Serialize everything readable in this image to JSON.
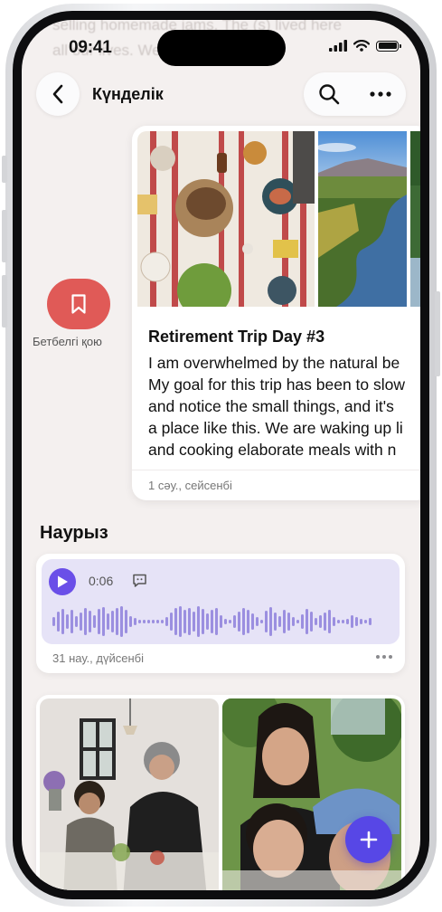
{
  "status_bar": {
    "time": "09:41"
  },
  "nav": {
    "title": "Күнделік"
  },
  "bookmark": {
    "label": "Бетбелгі қою"
  },
  "entry_card": {
    "title": "Retirement Trip Day #3",
    "body_lines": [
      "I am overwhelmed by the natural be",
      "My goal for this trip has been to slow",
      "and notice the small things, and it's",
      "a place like this. We are waking up li",
      "and cooking elaborate meals with n"
    ],
    "date": "1 сәу., сейсенбі"
  },
  "section": {
    "title": "Наурыз"
  },
  "audio_entry": {
    "duration": "0:06",
    "date": "31 нау., дүйсенбі"
  },
  "background_text": [
    "selling homemade jams. The (s) lived here",
    "all our lives. We"
  ],
  "colors": {
    "accent": "#5747e6",
    "bookmark": "#e05a57",
    "audio_background": "#e6e3f7",
    "waveform": "#9b8fe0"
  },
  "icons": {
    "back": "chevron-left-icon",
    "search": "magnifier-icon",
    "more": "ellipsis-icon",
    "bookmark": "bookmark-icon",
    "play": "play-icon",
    "transcript": "speech-bubble-icon",
    "add": "plus-icon"
  }
}
